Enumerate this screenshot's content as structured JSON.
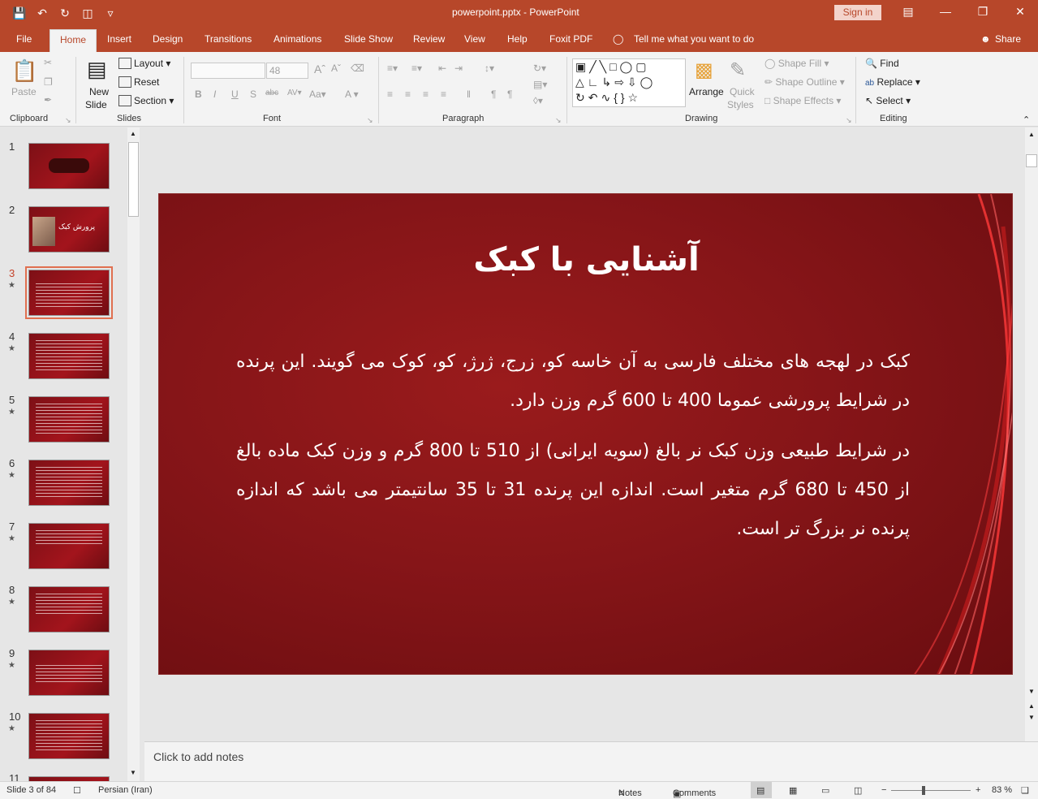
{
  "window": {
    "document_title": "powerpoint.pptx  -  PowerPoint",
    "sign_in": "Sign in"
  },
  "tabs": [
    {
      "label": "File"
    },
    {
      "label": "Home"
    },
    {
      "label": "Insert"
    },
    {
      "label": "Design"
    },
    {
      "label": "Transitions"
    },
    {
      "label": "Animations"
    },
    {
      "label": "Slide Show"
    },
    {
      "label": "Review"
    },
    {
      "label": "View"
    },
    {
      "label": "Help"
    },
    {
      "label": "Foxit PDF"
    }
  ],
  "tell_me": "Tell me what you want to do",
  "share": "Share",
  "ribbon": {
    "clipboard": {
      "label": "Clipboard",
      "paste": "Paste"
    },
    "slides": {
      "label": "Slides",
      "new_slide_1": "New",
      "new_slide_2": "Slide",
      "layout": "Layout",
      "reset": "Reset",
      "section": "Section"
    },
    "font": {
      "label": "Font",
      "font_size": "48"
    },
    "paragraph": {
      "label": "Paragraph"
    },
    "drawing": {
      "label": "Drawing",
      "arrange": "Arrange",
      "quick_styles_1": "Quick",
      "quick_styles_2": "Styles",
      "shape_fill": "Shape Fill",
      "shape_outline": "Shape Outline",
      "shape_effects": "Shape Effects"
    },
    "editing": {
      "label": "Editing",
      "find": "Find",
      "replace": "Replace",
      "select": "Select"
    }
  },
  "thumbnails": [
    {
      "num": "1",
      "star": "",
      "caption": ""
    },
    {
      "num": "2",
      "star": "",
      "caption": "پرورش کبک"
    },
    {
      "num": "3",
      "star": "★",
      "caption": ""
    },
    {
      "num": "4",
      "star": "★",
      "caption": ""
    },
    {
      "num": "5",
      "star": "★",
      "caption": ""
    },
    {
      "num": "6",
      "star": "★",
      "caption": ""
    },
    {
      "num": "7",
      "star": "★",
      "caption": ""
    },
    {
      "num": "8",
      "star": "★",
      "caption": ""
    },
    {
      "num": "9",
      "star": "★",
      "caption": ""
    },
    {
      "num": "10",
      "star": "★",
      "caption": ""
    },
    {
      "num": "11",
      "star": "",
      "caption": ""
    }
  ],
  "slide": {
    "title": "آشنایی با کبک",
    "paragraphs": [
      "کبک در لهجه های مختلف فارسی به آن خاسه کو، زرج، ژرژ، کو، کوک می گویند. این پرنده در شرایط پرورشی عموما 400 تا 600 گرم وزن دارد.",
      "در شرایط طبیعی وزن کبک نر بالغ (سویه ایرانی) از 510 تا 800 گرم و وزن کبک ماده بالغ از 450 تا 680 گرم متغیر است. اندازه این پرنده 31 تا 35 سانتیمتر می باشد که اندازه پرنده نر بزرگ تر است."
    ]
  },
  "notes_placeholder": "Click to add notes",
  "status": {
    "slide_counter": "Slide 3 of 84",
    "language": "Persian (Iran)",
    "notes": "Notes",
    "comments": "Comments",
    "zoom": "83 %"
  },
  "colors": {
    "brand": "#b7472a",
    "slide_bg": "#861518"
  }
}
